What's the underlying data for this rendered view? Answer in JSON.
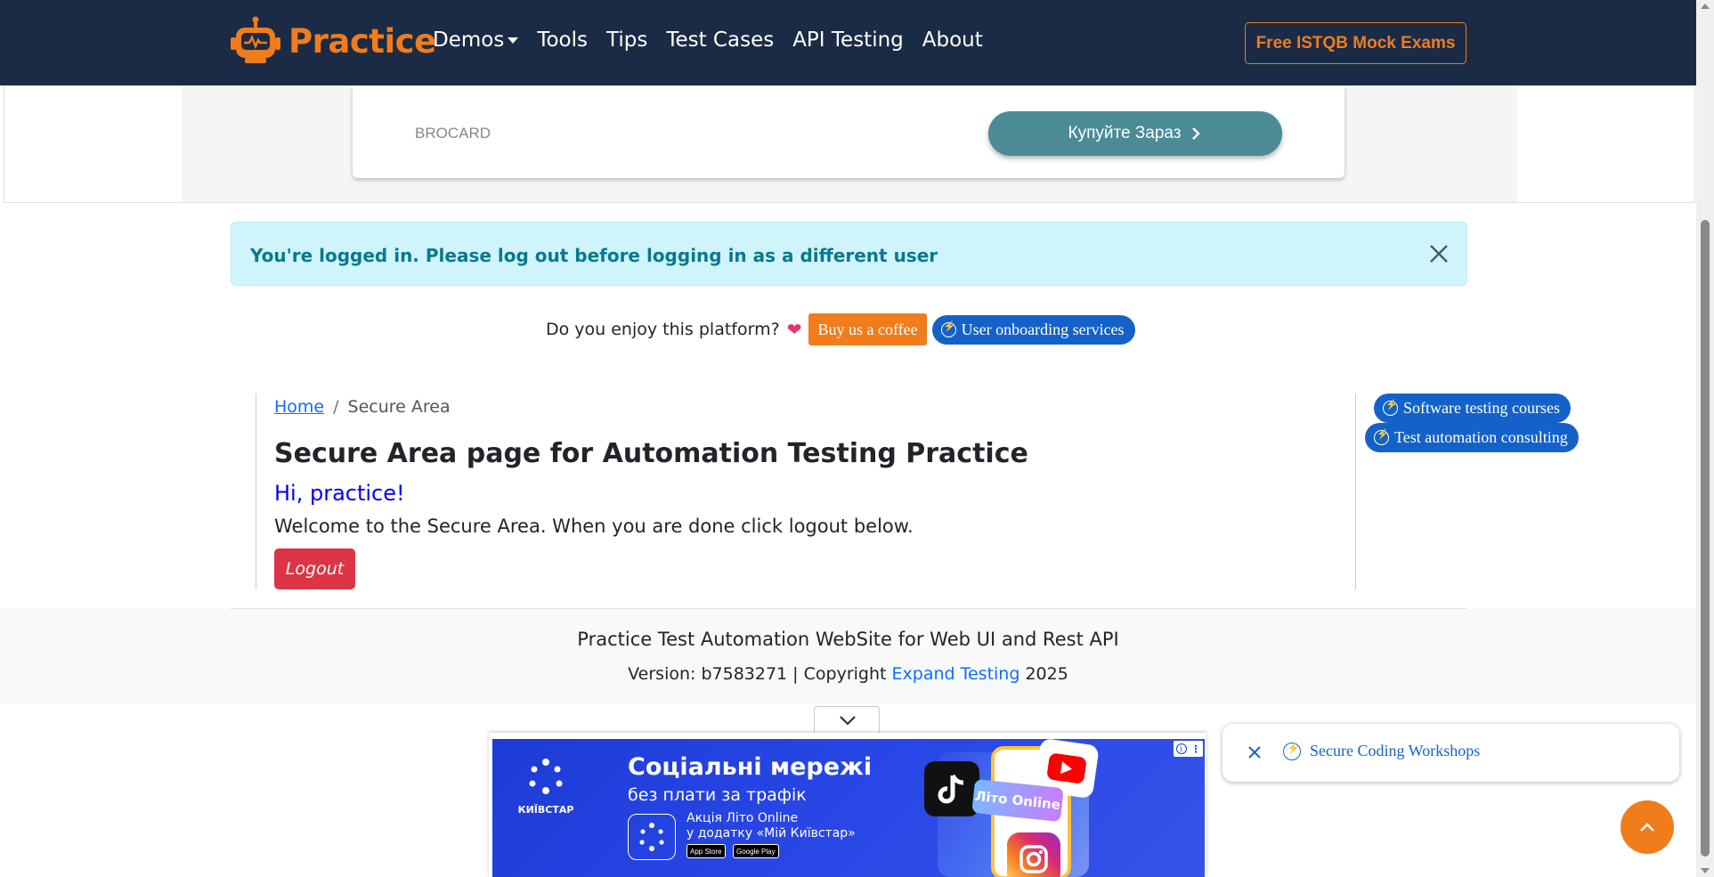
{
  "navbar": {
    "brand": "Practice",
    "items": [
      {
        "label": "Demos",
        "dropdown": true
      },
      {
        "label": "Tools"
      },
      {
        "label": "Tips"
      },
      {
        "label": "Test Cases"
      },
      {
        "label": "API Testing"
      },
      {
        "label": "About"
      }
    ],
    "cta": "Free ISTQB Mock Exams"
  },
  "ad_top": {
    "brand": "BROCARD",
    "cta": "Купуйте Зараз"
  },
  "alert": {
    "text": "You're logged in. Please log out before logging in as a different user"
  },
  "support": {
    "question": "Do you enjoy this platform?",
    "heart": "❤",
    "coffee": "Buy us a coffee",
    "onboarding": "User onboarding services"
  },
  "breadcrumb": {
    "home": "Home",
    "separator": "/",
    "current": "Secure Area"
  },
  "main": {
    "title": "Secure Area page for Automation Testing Practice",
    "greeting": "Hi, practice!",
    "welcome": "Welcome to the Secure Area. When you are done click logout below.",
    "logout": "Logout"
  },
  "side_links": [
    {
      "label": "Software testing courses"
    },
    {
      "label": "Test automation consulting"
    }
  ],
  "footer": {
    "title": "Practice Test Automation WebSite for Web UI and Rest API",
    "version_prefix": "Version: b7583271 | Copyright ",
    "company": "Expand Testing",
    "year": " 2025"
  },
  "bottom_ad": {
    "brand": "КИЇВСТАР",
    "headline": "Соціальні мережі",
    "subhead": "без плати за трафік",
    "line1": "Акція Літо Online",
    "line2": "у додатку «Мій Київстар»",
    "badge": "Літо Online",
    "app_store": "App Store",
    "google_play": "Google Play",
    "info": "i"
  },
  "popup": {
    "link": "Secure Coding Workshops"
  },
  "colors": {
    "nav_bg": "#1b2b45",
    "brand_orange": "#f07c1c",
    "alert_bg": "#cff4fc",
    "alert_text": "#087990",
    "pill_blue": "#1462c9",
    "logout_red": "#dc3545"
  }
}
